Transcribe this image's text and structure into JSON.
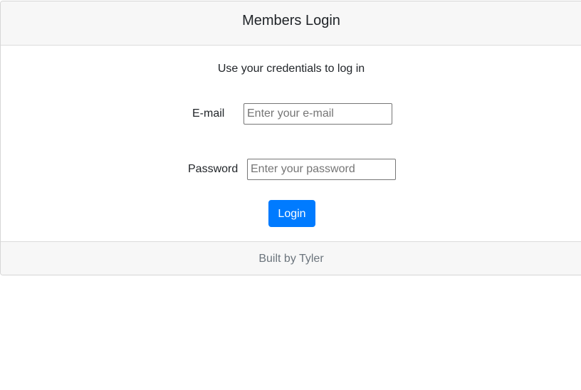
{
  "header": {
    "title": "Members Login"
  },
  "form": {
    "subtitle": "Use your credentials to log in",
    "email": {
      "label": "E-mail",
      "value": "",
      "placeholder": "Enter your e-mail"
    },
    "password": {
      "label": "Password",
      "value": "",
      "placeholder": "Enter your password"
    },
    "submit_label": "Login"
  },
  "footer": {
    "text": "Built by Tyler"
  },
  "colors": {
    "primary": "#007bff",
    "header_bg": "#f7f7f7",
    "muted_text": "#6c757d"
  }
}
